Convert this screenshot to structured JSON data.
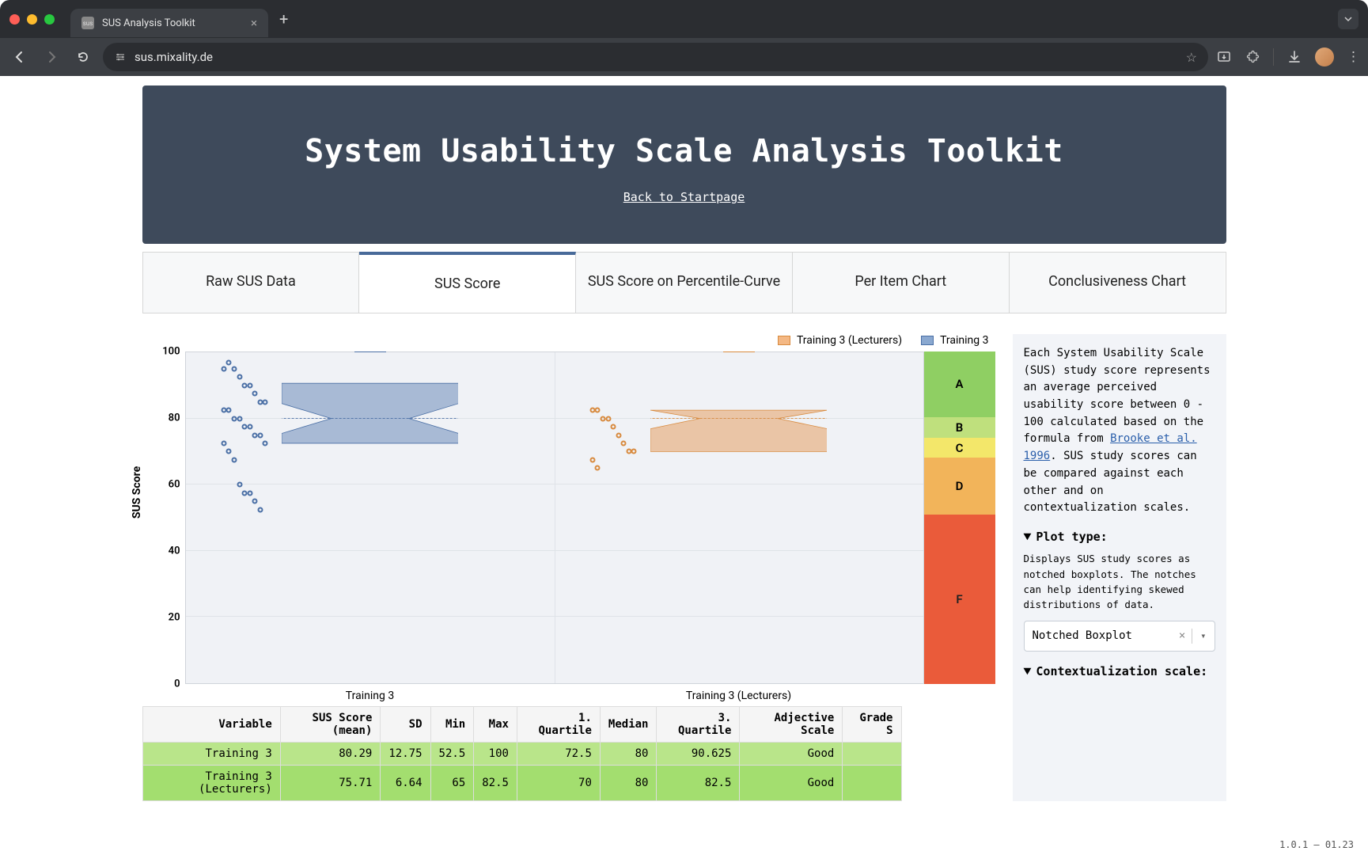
{
  "browser": {
    "tab_favicon_text": "sus",
    "tab_title": "SUS Analysis Toolkit",
    "url": "sus.mixality.de"
  },
  "header": {
    "title": "System Usability Scale Analysis Toolkit",
    "back_link": "Back to Startpage"
  },
  "tabs": [
    {
      "label": "Raw SUS Data"
    },
    {
      "label": "SUS Score"
    },
    {
      "label": "SUS Score on Percentile-Curve"
    },
    {
      "label": "Per Item Chart"
    },
    {
      "label": "Conclusiveness Chart"
    }
  ],
  "legend": {
    "a": "Training 3 (Lecturers)",
    "b": "Training 3"
  },
  "yaxis_label": "SUS Score",
  "yticks": [
    "0",
    "20",
    "40",
    "60",
    "80",
    "100"
  ],
  "xcats": [
    "Training 3",
    "Training 3 (Lecturers)"
  ],
  "grades": {
    "A": "A",
    "B": "B",
    "C": "C",
    "D": "D",
    "F": "F"
  },
  "side": {
    "p1a": "Each System Usability Scale (SUS) study score represents an average perceived usability score between 0 - 100 calculated based on the formula from ",
    "p1link": "Brooke et al. 1996",
    "p1b": ". SUS study scores can be compared against each other and on contextualization scales.",
    "plot_type_label": "Plot type:",
    "plot_type_desc": "Displays SUS study scores as notched boxplots. The notches can help identifying skewed distributions of data.",
    "plot_type_value": "Notched Boxplot",
    "context_label": "Contextualization scale:"
  },
  "table": {
    "headers": [
      "Variable",
      "SUS Score (mean)",
      "SD",
      "Min",
      "Max",
      "1. Quartile",
      "Median",
      "3. Quartile",
      "Adjective Scale",
      "Grade S"
    ],
    "rows": [
      [
        "Training 3",
        "80.29",
        "12.75",
        "52.5",
        "100",
        "72.5",
        "80",
        "90.625",
        "Good",
        ""
      ],
      [
        "Training 3 (Lecturers)",
        "75.71",
        "6.64",
        "65",
        "82.5",
        "70",
        "80",
        "82.5",
        "Good",
        ""
      ]
    ]
  },
  "version": "1.0.1 – 01.23",
  "chart_data": {
    "type": "boxplot",
    "ylabel": "SUS Score",
    "ylim": [
      0,
      100
    ],
    "grade_bands": [
      {
        "grade": "A",
        "from": 80.3,
        "to": 100
      },
      {
        "grade": "B",
        "from": 74,
        "to": 80.3
      },
      {
        "grade": "C",
        "from": 68,
        "to": 74
      },
      {
        "grade": "D",
        "from": 51,
        "to": 68
      },
      {
        "grade": "F",
        "from": 0,
        "to": 51
      }
    ],
    "series": [
      {
        "name": "Training 3",
        "color": "#4a6fa5",
        "min": 52.5,
        "q1": 72.5,
        "median": 80,
        "q3": 90.625,
        "max": 100,
        "mean": 80.29,
        "sd": 12.75,
        "points": [
          95,
          97,
          95,
          92.5,
          90,
          90,
          87.5,
          85,
          85,
          82.5,
          82.5,
          80,
          80,
          77.5,
          77.5,
          75,
          75,
          72.5,
          72.5,
          70,
          67.5,
          60,
          57.5,
          57.5,
          55,
          52.5
        ]
      },
      {
        "name": "Training 3 (Lecturers)",
        "color": "#d88a3e",
        "min": 65,
        "q1": 70,
        "median": 80,
        "q3": 82.5,
        "max": 82.5,
        "mean": 75.71,
        "sd": 6.64,
        "points": [
          82.5,
          82.5,
          80,
          80,
          77.5,
          75,
          72.5,
          70,
          70,
          67.5,
          65
        ]
      }
    ]
  }
}
